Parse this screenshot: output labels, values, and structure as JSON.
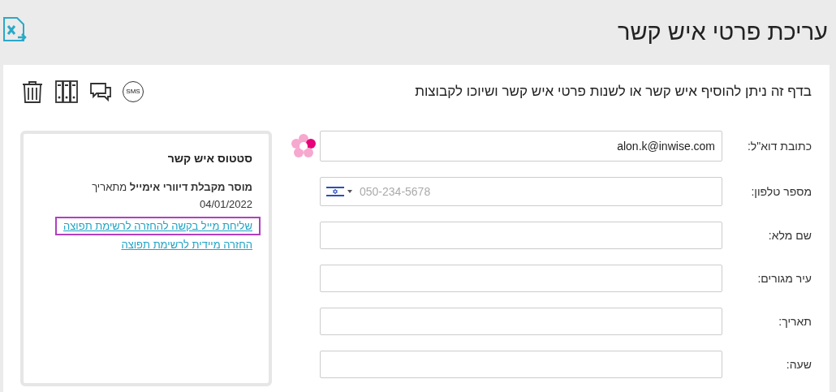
{
  "header": {
    "title": "עריכת פרטי איש קשר"
  },
  "description": "בדף זה ניתן להוסיף איש קשר או לשנות פרטי איש קשר ושיוכו לקבוצות",
  "toolbar": [
    {
      "kind": "sms",
      "label": "SMS"
    },
    {
      "kind": "chat"
    },
    {
      "kind": "binders"
    },
    {
      "kind": "trash"
    }
  ],
  "fields": [
    {
      "kind": "email",
      "label": "כתובת דוא\"ל:",
      "value": "alon.k@inwise.com"
    },
    {
      "kind": "phone",
      "label": "מספר טלפון:",
      "placeholder": "050-234-5678"
    },
    {
      "kind": "text",
      "label": "שם מלא:"
    },
    {
      "kind": "text",
      "label": "עיר מגורים:"
    },
    {
      "kind": "text",
      "label": "תאריך:"
    },
    {
      "kind": "text",
      "label": "שעה:"
    }
  ],
  "status_card": {
    "title": "סטטוס איש קשר",
    "status": "**מוסר מקבלת דיוורי אימייל** מתאריך",
    "date": "04/01/2022",
    "links": [
      {
        "text": "שליחת מייל בקשה להחזרה לרשימת תפוצה",
        "highlighted": true
      },
      {
        "text": "החזרה מיידית לרשימת תפוצה",
        "highlighted": false
      }
    ]
  }
}
